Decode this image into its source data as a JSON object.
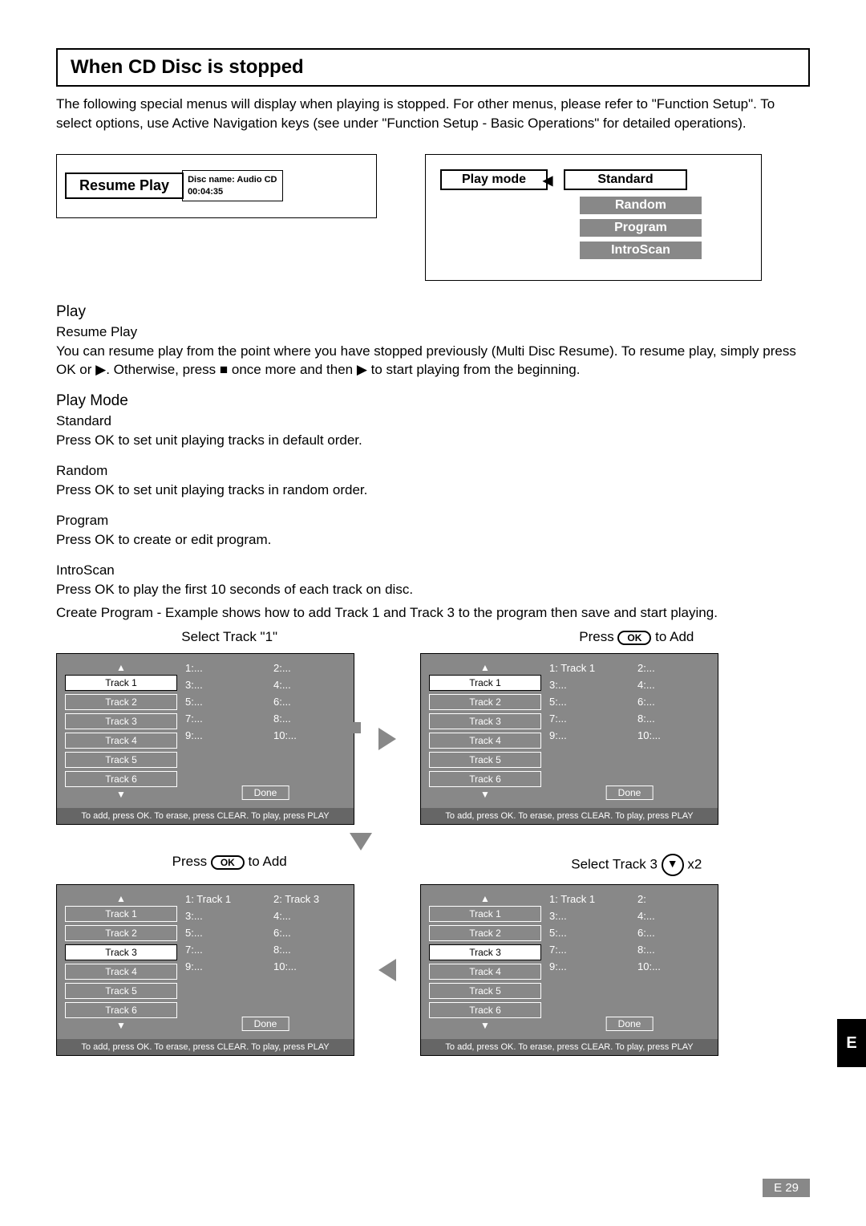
{
  "title": "When CD Disc is stopped",
  "intro": "The following special menus will display when playing is stopped. For other menus, please refer to \"Function Setup\". To select options, use Active Navigation keys (see under \"Function Setup - Basic Operations\" for detailed operations).",
  "resume_play": {
    "label": "Resume Play",
    "disc_name_label": "Disc name: Audio CD",
    "time": "00:04:35"
  },
  "play_mode": {
    "label": "Play mode",
    "options": [
      "Standard",
      "Random",
      "Program",
      "IntroScan"
    ]
  },
  "sections": {
    "play_h": "Play",
    "resume_h": "Resume Play",
    "resume_p": "You can resume play from the point where you have stopped previously (Multi Disc Resume). To resume play, simply press OK or ▶. Otherwise, press ■ once more and then ▶ to start playing from the beginning.",
    "playmode_h": "Play Mode",
    "std_h": "Standard",
    "std_p": "Press OK to set unit playing tracks in default order.",
    "rnd_h": "Random",
    "rnd_p": "Press OK to set unit playing tracks in random order.",
    "prg_h": "Program",
    "prg_p": "Press OK to create or edit program.",
    "isc_h": "IntroScan",
    "isc_p": "Press OK to play the first 10 seconds of each track on disc.",
    "create_p": "Create Program   - Example shows how to add Track 1 and Track 3 to the program then save and start playing."
  },
  "steps": {
    "s1": "Select Track \"1\"",
    "s2_a": "Press ",
    "s2_b": " to  Add",
    "s3_a": "Select Track 3  ",
    "s3_b": "  x2",
    "ok": "OK",
    "down": "▼"
  },
  "panel": {
    "tracks": [
      "Track  1",
      "Track  2",
      "Track  3",
      "Track  4",
      "Track  5",
      "Track  6"
    ],
    "done": "Done",
    "hint": "To add, press OK. To erase, press CLEAR. To play, press PLAY",
    "empty_slots": [
      "1:...",
      "2:...",
      "3:...",
      "4:...",
      "5:...",
      "6:...",
      "7:...",
      "8:...",
      "9:...",
      "10:..."
    ],
    "slots_b": [
      "1:  Track  1",
      "2:...",
      "3:...",
      "4:...",
      "5:...",
      "6:...",
      "7:...",
      "8:...",
      "9:...",
      "10:..."
    ],
    "slots_c": [
      "1:  Track  1",
      "2:",
      "3:...",
      "4:...",
      "5:...",
      "6:...",
      "7:...",
      "8:...",
      "9:...",
      "10:..."
    ],
    "slots_d": [
      "1:  Track  1",
      "2:  Track  3",
      "3:...",
      "4:...",
      "5:...",
      "6:...",
      "7:...",
      "8:...",
      "9:...",
      "10:..."
    ]
  },
  "page_num": "E 29",
  "side_tab": "E"
}
